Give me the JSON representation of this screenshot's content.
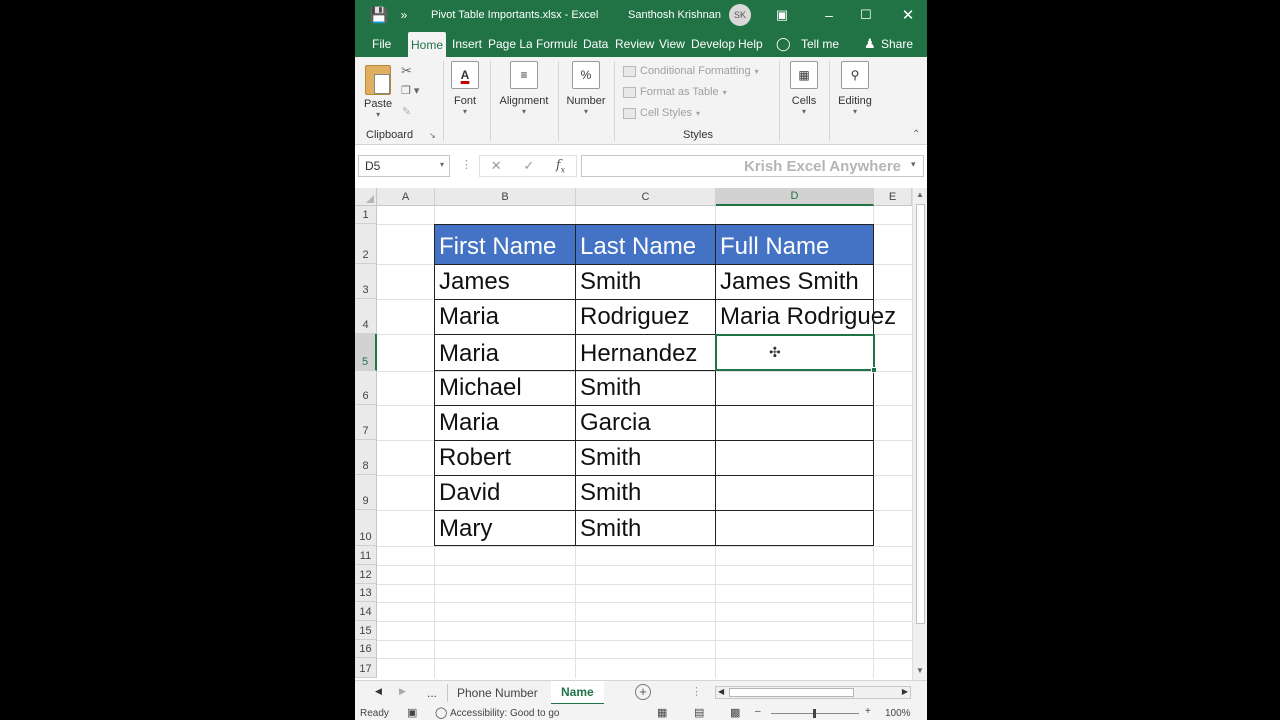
{
  "titlebar": {
    "title": "Pivot Table Importants.xlsx  -  Excel",
    "user": "Santhosh Krishnan",
    "avatar_initials": "SK"
  },
  "tabs": [
    "File",
    "Home",
    "Insert",
    "Page La",
    "Formula",
    "Data",
    "Review",
    "View",
    "Develop",
    "Help"
  ],
  "tell_me": "Tell me",
  "share": "Share",
  "ribbon": {
    "paste": "Paste",
    "clipboard": "Clipboard",
    "font": "Font",
    "alignment": "Alignment",
    "number": "Number",
    "conditional_formatting": "Conditional Formatting",
    "format_as_table": "Format as Table",
    "cell_styles": "Cell Styles",
    "styles": "Styles",
    "cells": "Cells",
    "editing": "Editing"
  },
  "formula_bar": {
    "name_box": "D5",
    "value": "Krish Excel Anywhere"
  },
  "columns": [
    "A",
    "B",
    "C",
    "D",
    "E"
  ],
  "rows": [
    "1",
    "2",
    "3",
    "4",
    "5",
    "6",
    "7",
    "8",
    "9",
    "10",
    "11",
    "12",
    "13",
    "14",
    "15",
    "16",
    "17"
  ],
  "selected_cell": "D5",
  "table": {
    "headers": [
      "First Name",
      "Last Name",
      "Full Name"
    ],
    "rows": [
      [
        "James",
        "Smith",
        "James Smith"
      ],
      [
        "Maria",
        "Rodriguez",
        "Maria Rodriguez"
      ],
      [
        "Maria",
        "Hernandez",
        ""
      ],
      [
        "Michael",
        "Smith",
        ""
      ],
      [
        "Maria",
        "Garcia",
        ""
      ],
      [
        "Robert",
        "Smith",
        ""
      ],
      [
        "David",
        "Smith",
        ""
      ],
      [
        "Mary",
        "Smith",
        ""
      ]
    ]
  },
  "sheets": {
    "ellipsis": "...",
    "list": [
      "Phone Number",
      "Name"
    ],
    "active": "Name"
  },
  "status": {
    "ready": "Ready",
    "accessibility": "Accessibility: Good to go",
    "zoom": "100%"
  },
  "colors": {
    "excel_green": "#217346",
    "header_blue": "#4472c4"
  }
}
